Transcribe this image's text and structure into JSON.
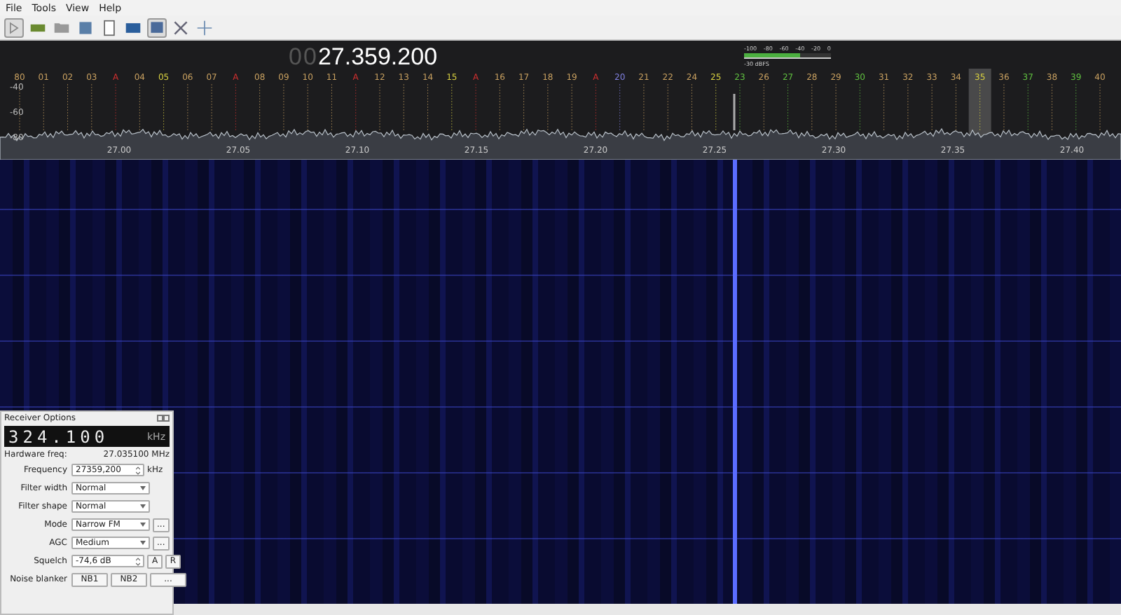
{
  "menu": [
    {
      "label": "File"
    },
    {
      "label": "Tools"
    },
    {
      "label": "View"
    },
    {
      "label": "Help"
    }
  ],
  "toolbar": [
    {
      "pressed": true
    },
    {
      "pressed": false
    },
    {
      "pressed": false
    },
    {
      "pressed": false
    },
    {
      "pressed": false
    },
    {
      "pressed": false
    },
    {
      "pressed": true
    },
    {
      "pressed": false
    },
    {
      "pressed": false
    }
  ],
  "frequency_display": {
    "leading_digits": [
      "0",
      "0"
    ],
    "value": "27.359.200"
  },
  "meter": {
    "scale": [
      "-100",
      "-80",
      "-60",
      "-40",
      "-20",
      "0"
    ],
    "level": 0.65,
    "reading": "-30 dBFS"
  },
  "spectrum": {
    "y_ticks": [
      "-40",
      "-60",
      "-80"
    ],
    "x_ticks": [
      "27.00",
      "27.05",
      "27.10",
      "27.15",
      "27.20",
      "27.25",
      "27.30",
      "27.35",
      "27.40"
    ],
    "channels": [
      {
        "label": "80",
        "color": "#c8a060",
        "selected": false
      },
      {
        "label": "01",
        "color": "#c8a060",
        "selected": false
      },
      {
        "label": "02",
        "color": "#c8a060",
        "selected": false
      },
      {
        "label": "03",
        "color": "#c8a060",
        "selected": false
      },
      {
        "label": "A",
        "color": "#d03030",
        "selected": false
      },
      {
        "label": "04",
        "color": "#c8a060",
        "selected": false
      },
      {
        "label": "05",
        "color": "#d8d040",
        "selected": false
      },
      {
        "label": "06",
        "color": "#c8a060",
        "selected": false
      },
      {
        "label": "07",
        "color": "#c8a060",
        "selected": false
      },
      {
        "label": "A",
        "color": "#d03030",
        "selected": false
      },
      {
        "label": "08",
        "color": "#c8a060",
        "selected": false
      },
      {
        "label": "09",
        "color": "#c8a060",
        "selected": false
      },
      {
        "label": "10",
        "color": "#c8a060",
        "selected": false
      },
      {
        "label": "11",
        "color": "#c8a060",
        "selected": false
      },
      {
        "label": "A",
        "color": "#d03030",
        "selected": false
      },
      {
        "label": "12",
        "color": "#c8a060",
        "selected": false
      },
      {
        "label": "13",
        "color": "#c8a060",
        "selected": false
      },
      {
        "label": "14",
        "color": "#c8a060",
        "selected": false
      },
      {
        "label": "15",
        "color": "#d8d040",
        "selected": false
      },
      {
        "label": "A",
        "color": "#d03030",
        "selected": false
      },
      {
        "label": "16",
        "color": "#c8a060",
        "selected": false
      },
      {
        "label": "17",
        "color": "#c8a060",
        "selected": false
      },
      {
        "label": "18",
        "color": "#c8a060",
        "selected": false
      },
      {
        "label": "19",
        "color": "#c8a060",
        "selected": false
      },
      {
        "label": "A",
        "color": "#d03030",
        "selected": false
      },
      {
        "label": "20",
        "color": "#8080e0",
        "selected": false
      },
      {
        "label": "21",
        "color": "#c8a060",
        "selected": false
      },
      {
        "label": "22",
        "color": "#c8a060",
        "selected": false
      },
      {
        "label": "24",
        "color": "#c8a060",
        "selected": false
      },
      {
        "label": "25",
        "color": "#d8d040",
        "selected": false
      },
      {
        "label": "23",
        "color": "#60c040",
        "selected": false
      },
      {
        "label": "26",
        "color": "#c8a060",
        "selected": false
      },
      {
        "label": "27",
        "color": "#60c040",
        "selected": false
      },
      {
        "label": "28",
        "color": "#c8a060",
        "selected": false
      },
      {
        "label": "29",
        "color": "#c8a060",
        "selected": false
      },
      {
        "label": "30",
        "color": "#60c040",
        "selected": false
      },
      {
        "label": "31",
        "color": "#c8a060",
        "selected": false
      },
      {
        "label": "32",
        "color": "#c8a060",
        "selected": false
      },
      {
        "label": "33",
        "color": "#c8a060",
        "selected": false
      },
      {
        "label": "34",
        "color": "#c8a060",
        "selected": false
      },
      {
        "label": "35",
        "color": "#d8d040",
        "selected": true
      },
      {
        "label": "36",
        "color": "#c8a060",
        "selected": false
      },
      {
        "label": "37",
        "color": "#60c040",
        "selected": false
      },
      {
        "label": "38",
        "color": "#c8a060",
        "selected": false
      },
      {
        "label": "39",
        "color": "#60c040",
        "selected": false
      },
      {
        "label": "40",
        "color": "#c8a060",
        "selected": false
      }
    ]
  },
  "receiver_options": {
    "title": "Receiver Options",
    "display": {
      "digits": "324.100",
      "unit": "kHz"
    },
    "hardware_freq": {
      "label": "Hardware freq:",
      "value": "27.035100 MHz"
    },
    "rows": [
      {
        "kind": "spin",
        "label": "Frequency",
        "value": "27359,200",
        "unit": "kHz"
      },
      {
        "kind": "combo",
        "label": "Filter width",
        "value": "Normal"
      },
      {
        "kind": "combo",
        "label": "Filter shape",
        "value": "Normal"
      },
      {
        "kind": "combo",
        "label": "Mode",
        "value": "Narrow FM",
        "buttons": [
          "..."
        ]
      },
      {
        "kind": "combo",
        "label": "AGC",
        "value": "Medium",
        "buttons": [
          "..."
        ]
      },
      {
        "kind": "spin",
        "label": "Squelch",
        "value": "-74,6 dB",
        "buttons": [
          "A",
          "R"
        ]
      },
      {
        "kind": "buttons",
        "label": "Noise blanker",
        "buttons": [
          "NB1",
          "NB2",
          "..."
        ]
      }
    ]
  }
}
